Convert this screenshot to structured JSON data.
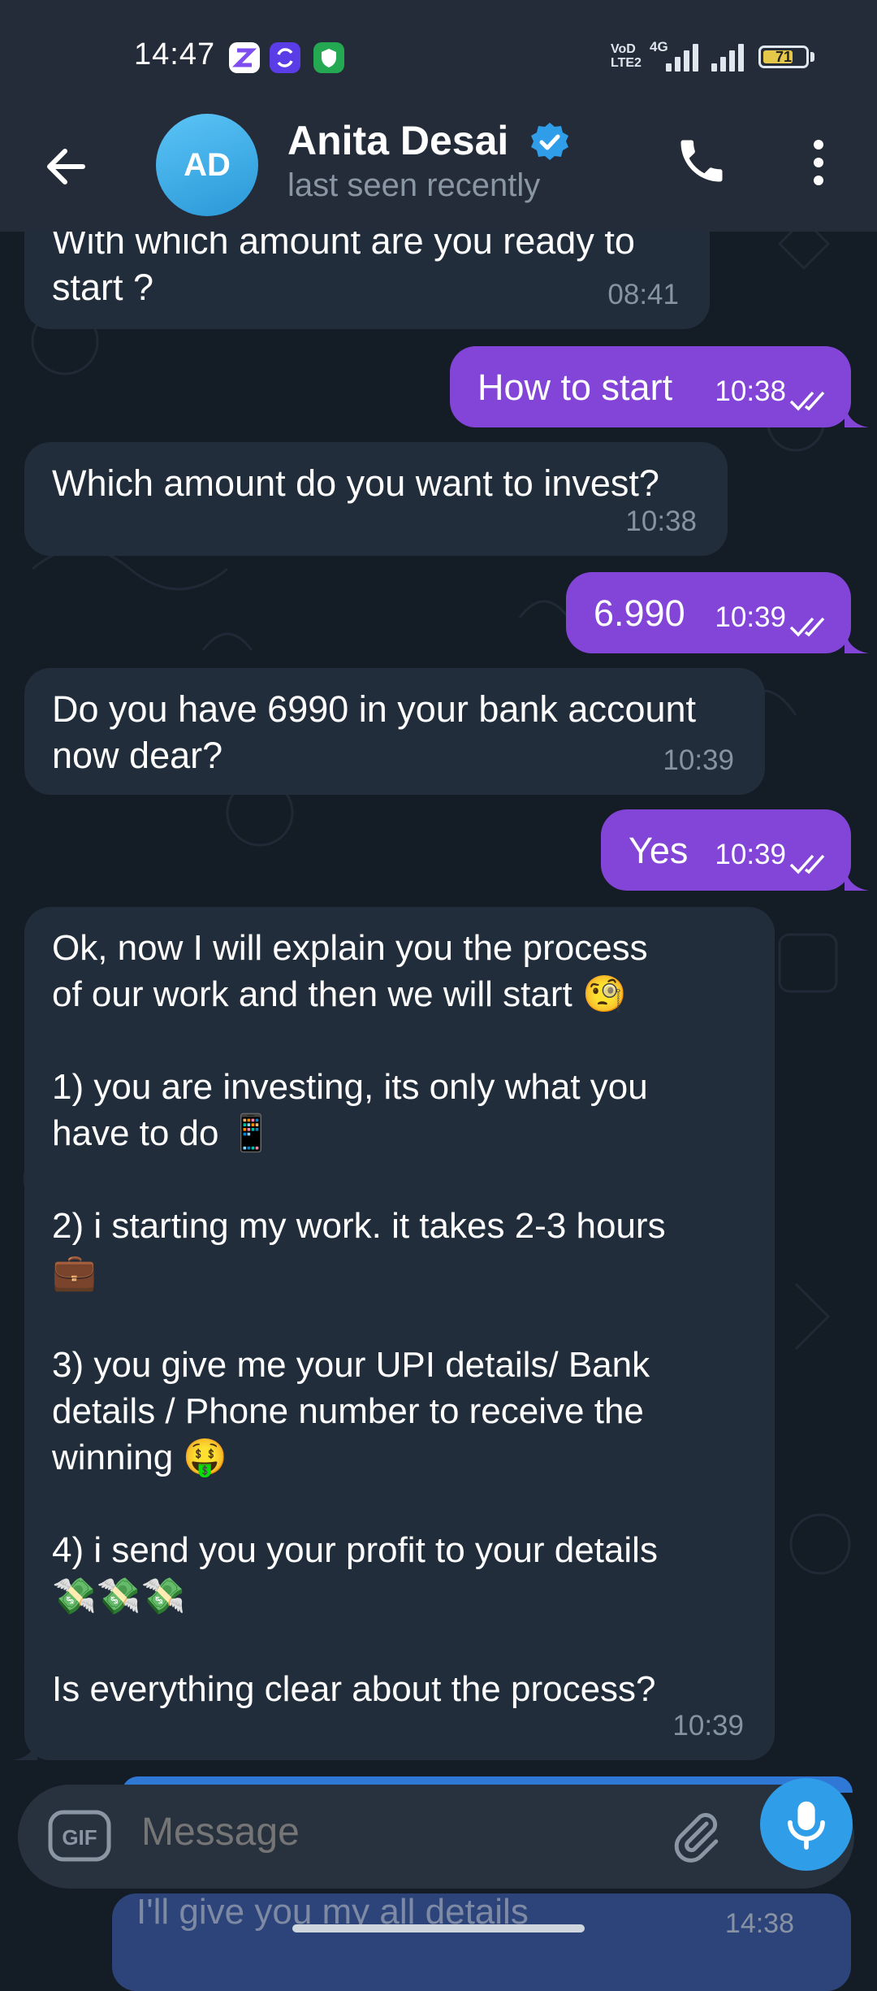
{
  "status_bar": {
    "time": "14:47",
    "network_label": "4G",
    "volte_label": "VoD\nLTE2",
    "battery_level": 71,
    "battery_text": "71"
  },
  "header": {
    "avatar_initials": "AD",
    "contact_name": "Anita Desai",
    "status": "last seen recently"
  },
  "messages": [
    {
      "dir": "in",
      "lines": [
        "With which amount are you ready to",
        "start ?"
      ],
      "time": "08:41"
    },
    {
      "dir": "out",
      "lines": [
        "How to start"
      ],
      "time": "10:38"
    },
    {
      "dir": "in",
      "lines": [
        "Which amount do you want to invest?"
      ],
      "time": "10:38"
    },
    {
      "dir": "out",
      "lines": [
        "6.990"
      ],
      "time": "10:39"
    },
    {
      "dir": "in",
      "lines": [
        "Do you have 6990 in your bank account",
        "now dear?"
      ],
      "time": "10:39"
    },
    {
      "dir": "out",
      "lines": [
        "Yes"
      ],
      "time": "10:39"
    },
    {
      "dir": "in",
      "lines": [
        "Ok, now I will explain you the process",
        "of our work and then we will start 🧐",
        "",
        "1) you are investing, its only what you",
        "have to do 📱",
        "",
        "2) i starting my work. it takes 2-3 hours",
        "💼",
        "",
        "3) you give me your UPI details/ Bank",
        "details / Phone number to receive the",
        "winning 🤑",
        "",
        "4) i send you your profit to your details",
        "💸💸💸",
        "",
        "Is everything clear about the process?"
      ],
      "time": "10:39"
    }
  ],
  "composer": {
    "placeholder": "Message",
    "gif_label": "GIF"
  },
  "partial_message": {
    "text": "I'll give you my all details",
    "time": "14:38"
  },
  "colors": {
    "incoming_bubble": "#212d3b",
    "outgoing_bubble": "#8344d8",
    "header": "#232c38",
    "accent": "#2f9de8"
  }
}
